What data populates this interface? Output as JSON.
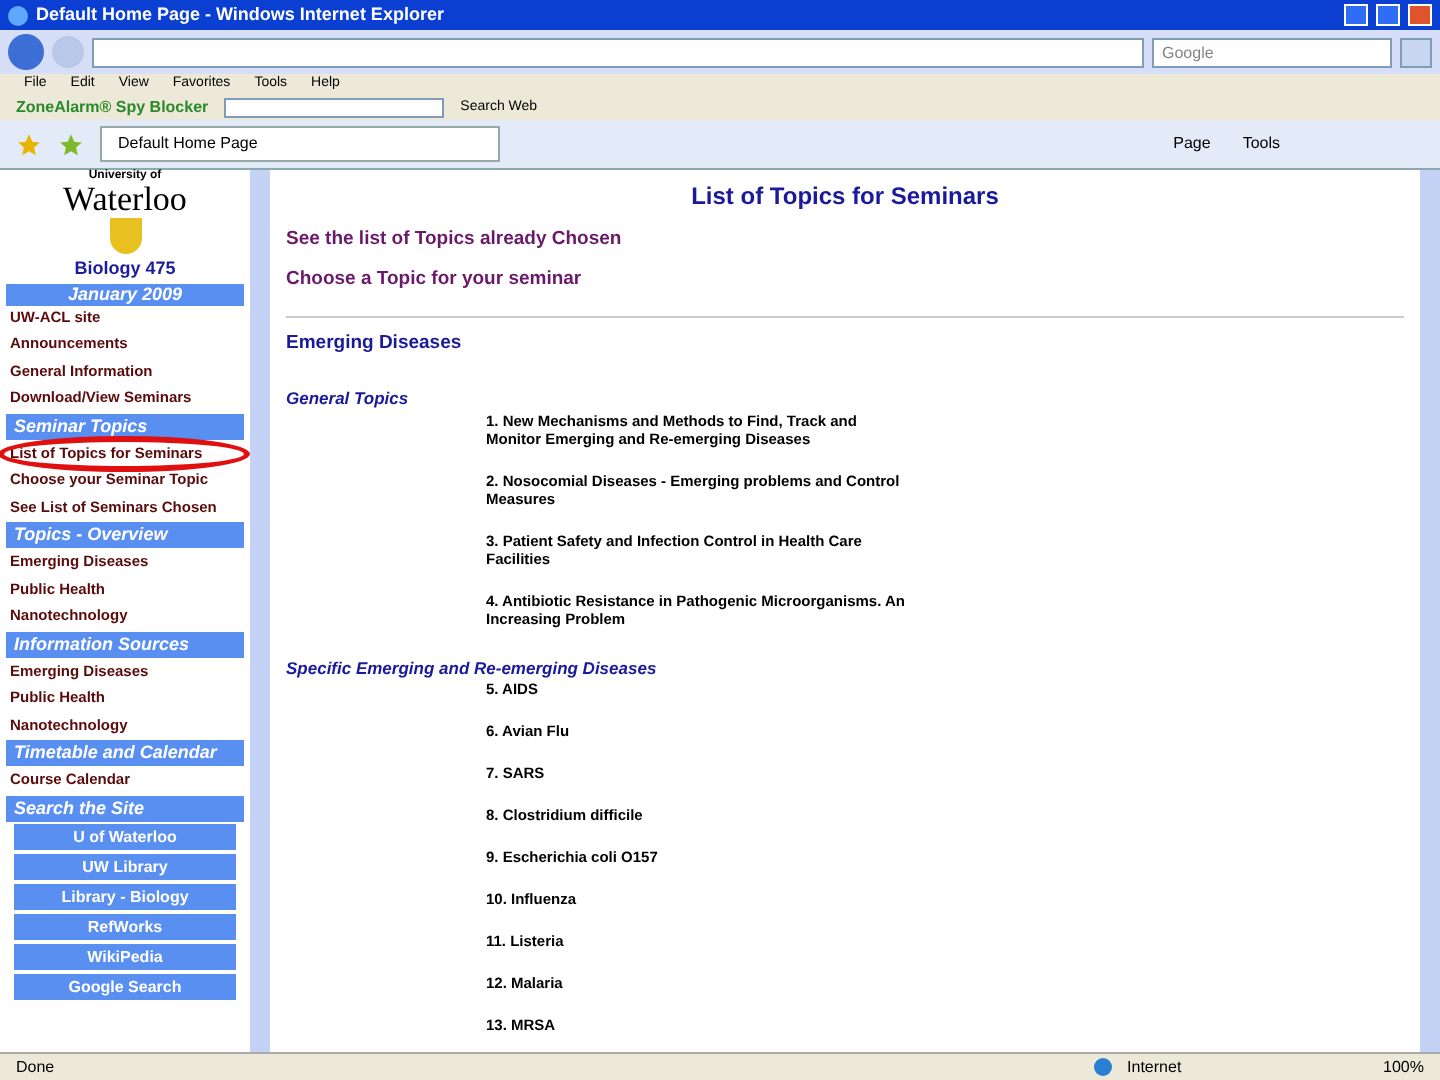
{
  "window": {
    "title": "Default Home Page - Windows Internet Explorer"
  },
  "search": {
    "placeholder": "Google"
  },
  "menu": [
    "File",
    "Edit",
    "View",
    "Favorites",
    "Tools",
    "Help"
  ],
  "toolbar": {
    "brand": "ZoneAlarm® Spy Blocker",
    "search_label": "Search Web"
  },
  "tab": {
    "label": "Default Home Page"
  },
  "commands": [
    "Page",
    "Tools"
  ],
  "sidebar": {
    "university_small": "University of",
    "university": "Waterloo",
    "course": "Biology 475",
    "term": "January 2009",
    "sections": [
      {
        "kind": "links",
        "items": [
          {
            "label": "UW-ACL site",
            "highlighted": false
          },
          {
            "label": "Announcements",
            "highlighted": false
          },
          {
            "label": "General Information",
            "highlighted": false
          },
          {
            "label": "Download/View Seminars",
            "highlighted": false
          }
        ]
      },
      {
        "kind": "header",
        "label": "Seminar Topics"
      },
      {
        "kind": "links",
        "items": [
          {
            "label": "List of Topics for Seminars",
            "highlighted": true
          },
          {
            "label": "Choose your Seminar Topic",
            "highlighted": false
          },
          {
            "label": "See List of Seminars Chosen",
            "highlighted": false
          }
        ]
      },
      {
        "kind": "header",
        "label": "Topics - Overview"
      },
      {
        "kind": "links",
        "items": [
          {
            "label": "Emerging Diseases",
            "highlighted": false
          },
          {
            "label": "Public Health",
            "highlighted": false
          },
          {
            "label": "Nanotechnology",
            "highlighted": false
          }
        ]
      },
      {
        "kind": "header",
        "label": "Information Sources"
      },
      {
        "kind": "links",
        "items": [
          {
            "label": "Emerging Diseases",
            "highlighted": false
          },
          {
            "label": "Public Health",
            "highlighted": false
          },
          {
            "label": "Nanotechnology",
            "highlighted": false
          }
        ]
      },
      {
        "kind": "header",
        "label": "Timetable and Calendar"
      },
      {
        "kind": "links",
        "items": [
          {
            "label": "Course Calendar",
            "highlighted": false
          }
        ]
      },
      {
        "kind": "header",
        "label": "Search the Site"
      },
      {
        "kind": "buttons",
        "items": [
          {
            "label": "U of Waterloo",
            "highlighted": false
          },
          {
            "label": "UW Library",
            "highlighted": false
          },
          {
            "label": "Library - Biology",
            "highlighted": false
          },
          {
            "label": "RefWorks",
            "highlighted": false
          },
          {
            "label": "WikiPedia",
            "highlighted": false
          },
          {
            "label": "Google Search",
            "highlighted": false
          }
        ]
      }
    ]
  },
  "main": {
    "title": "List of Topics for Seminars",
    "links": [
      "See the list of Topics already Chosen",
      "Choose a Topic for your seminar"
    ],
    "heading": "Emerging Diseases",
    "groups": [
      {
        "title": "General Topics",
        "topics": [
          "1. New Mechanisms and Methods to Find, Track and Monitor Emerging and Re-emerging Diseases",
          "2. Nosocomial Diseases - Emerging problems and Control Measures",
          "3. Patient Safety and Infection Control in Health Care Facilities",
          "4. Antibiotic Resistance in Pathogenic Microorganisms. An Increasing Problem"
        ]
      },
      {
        "title": "Specific Emerging and Re-emerging Diseases",
        "topics": [
          "5. AIDS",
          "6. Avian Flu",
          "7. SARS",
          "8. Clostridium difficile",
          "9. Escherichia coli O157",
          "10. Influenza",
          "11. Listeria",
          "12. Malaria",
          "13. MRSA"
        ]
      }
    ]
  },
  "status_bar": {
    "status": "Done",
    "zone": "Internet",
    "zoom": "100%"
  }
}
